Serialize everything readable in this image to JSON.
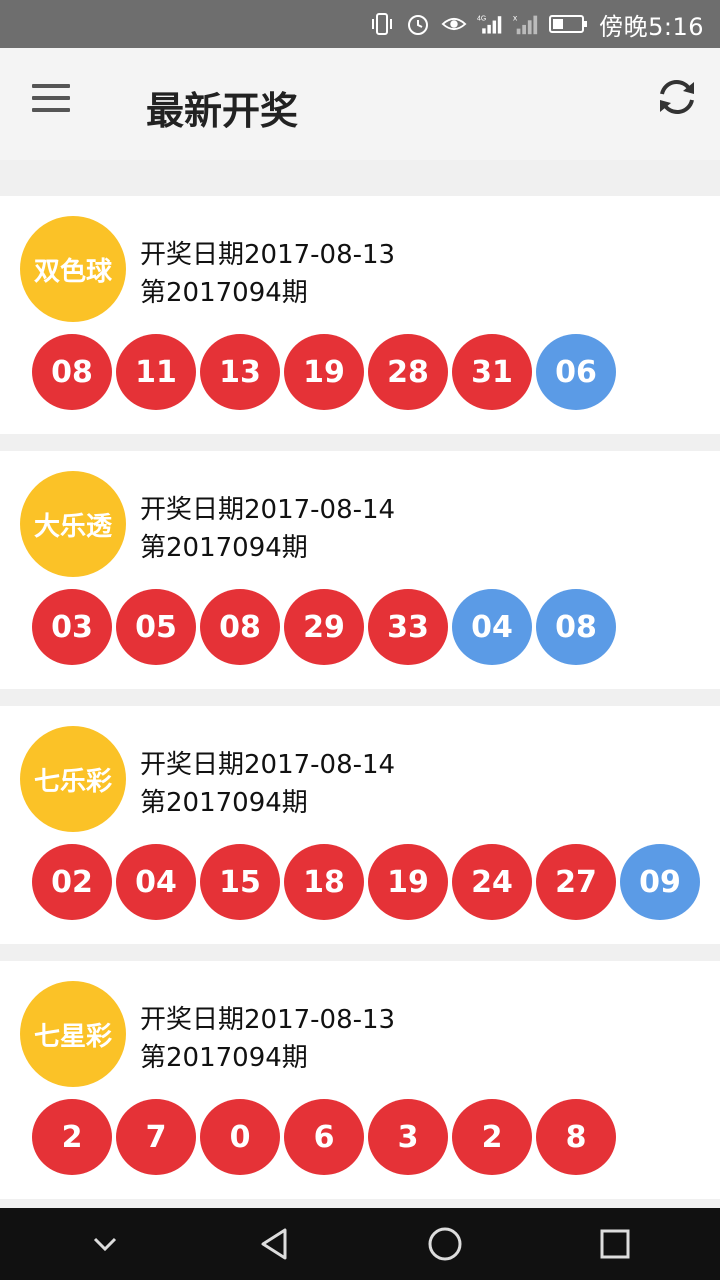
{
  "status_bar": {
    "time": "傍晚5:16",
    "icons": [
      "vibrate-icon",
      "alarm-icon",
      "eye-icon",
      "signal-4g-icon",
      "signal-icon",
      "battery-icon"
    ]
  },
  "app_bar": {
    "title": "最新开奖",
    "menu_icon": "menu-icon",
    "refresh_icon": "refresh-icon"
  },
  "colors": {
    "badge": "#fbc227",
    "red_ball": "#e53237",
    "blue_ball": "#5b9be6"
  },
  "lotteries": [
    {
      "name": "双色球",
      "date": "开奖日期2017-08-13",
      "issue": "第2017094期",
      "balls": [
        {
          "n": "08",
          "color": "red"
        },
        {
          "n": "11",
          "color": "red"
        },
        {
          "n": "13",
          "color": "red"
        },
        {
          "n": "19",
          "color": "red"
        },
        {
          "n": "28",
          "color": "red"
        },
        {
          "n": "31",
          "color": "red"
        },
        {
          "n": "06",
          "color": "blue"
        }
      ]
    },
    {
      "name": "大乐透",
      "date": "开奖日期2017-08-14",
      "issue": "第2017094期",
      "balls": [
        {
          "n": "03",
          "color": "red"
        },
        {
          "n": "05",
          "color": "red"
        },
        {
          "n": "08",
          "color": "red"
        },
        {
          "n": "29",
          "color": "red"
        },
        {
          "n": "33",
          "color": "red"
        },
        {
          "n": "04",
          "color": "blue"
        },
        {
          "n": "08",
          "color": "blue"
        }
      ]
    },
    {
      "name": "七乐彩",
      "date": "开奖日期2017-08-14",
      "issue": "第2017094期",
      "balls": [
        {
          "n": "02",
          "color": "red"
        },
        {
          "n": "04",
          "color": "red"
        },
        {
          "n": "15",
          "color": "red"
        },
        {
          "n": "18",
          "color": "red"
        },
        {
          "n": "19",
          "color": "red"
        },
        {
          "n": "24",
          "color": "red"
        },
        {
          "n": "27",
          "color": "red"
        },
        {
          "n": "09",
          "color": "blue"
        }
      ]
    },
    {
      "name": "七星彩",
      "date": "开奖日期2017-08-13",
      "issue": "第2017094期",
      "balls": [
        {
          "n": "2",
          "color": "red"
        },
        {
          "n": "7",
          "color": "red"
        },
        {
          "n": "0",
          "color": "red"
        },
        {
          "n": "6",
          "color": "red"
        },
        {
          "n": "3",
          "color": "red"
        },
        {
          "n": "2",
          "color": "red"
        },
        {
          "n": "8",
          "color": "red"
        }
      ]
    }
  ],
  "nav_bar": {
    "buttons": [
      "collapse-icon",
      "back-icon",
      "home-icon",
      "recents-icon"
    ]
  }
}
